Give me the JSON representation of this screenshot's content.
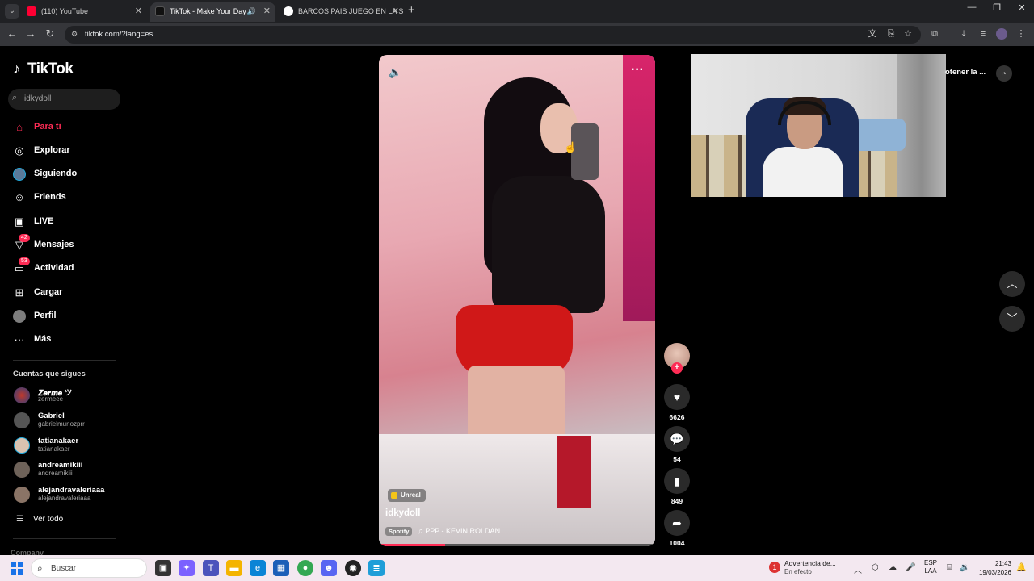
{
  "browser": {
    "tabs": [
      {
        "title": "(110) YouTube",
        "favicon": "youtube-icon",
        "active": false
      },
      {
        "title": "TikTok - Make Your Day",
        "favicon": "tiktok-icon",
        "active": true
      },
      {
        "title": "BARCOS PAIS JUEGO EN LA SEI",
        "favicon": "google-icon",
        "active": false
      }
    ],
    "url": "tiktok.com/?lang=es"
  },
  "tiktok": {
    "logo": "TikTok",
    "search_value": "idkydoll",
    "nav": [
      {
        "label": "Para ti",
        "icon": "home-icon",
        "active": true
      },
      {
        "label": "Explorar",
        "icon": "compass-icon"
      },
      {
        "label": "Siguiendo",
        "icon": "following-avatar-icon"
      },
      {
        "label": "Friends",
        "icon": "friends-icon"
      },
      {
        "label": "LIVE",
        "icon": "live-icon"
      },
      {
        "label": "Mensajes",
        "icon": "messages-icon",
        "badge": "42"
      },
      {
        "label": "Actividad",
        "icon": "activity-icon",
        "badge": "53"
      },
      {
        "label": "Cargar",
        "icon": "upload-icon"
      },
      {
        "label": "Perfil",
        "icon": "profile-avatar-icon"
      },
      {
        "label": "Más",
        "icon": "more-dots-icon"
      }
    ],
    "following_title": "Cuentas que sigues",
    "following": [
      {
        "name": "𝒁𝒆𝒓𝒎𝒆 ツ",
        "handle": "zermeee"
      },
      {
        "name": "Gabriel",
        "handle": "gabrielmunozprr"
      },
      {
        "name": "tatianakaer",
        "handle": "tatianakaer"
      },
      {
        "name": "andreamikiii",
        "handle": "andreamikiii"
      },
      {
        "name": "alejandravaleriaaa",
        "handle": "alejandravaleriaaa"
      }
    ],
    "see_all": "Ver todo",
    "company": "Company",
    "video": {
      "tag": "Unreal",
      "author": "idkydoll",
      "music_source": "Spotify",
      "music": "PPP - KEVIN ROLDAN",
      "progress": 0.24
    },
    "actions": {
      "likes": "6626",
      "comments": "54",
      "saves": "849",
      "shares": "1004"
    },
    "get_app": "otener la ..."
  },
  "taskbar": {
    "search_placeholder": "Buscar",
    "notification_title": "Advertencia de...",
    "notification_sub": "En efecto",
    "notification_count": "1",
    "lang_1": "ESP",
    "lang_2": "LAA",
    "time": "21:43",
    "date": "19/03/2026"
  }
}
